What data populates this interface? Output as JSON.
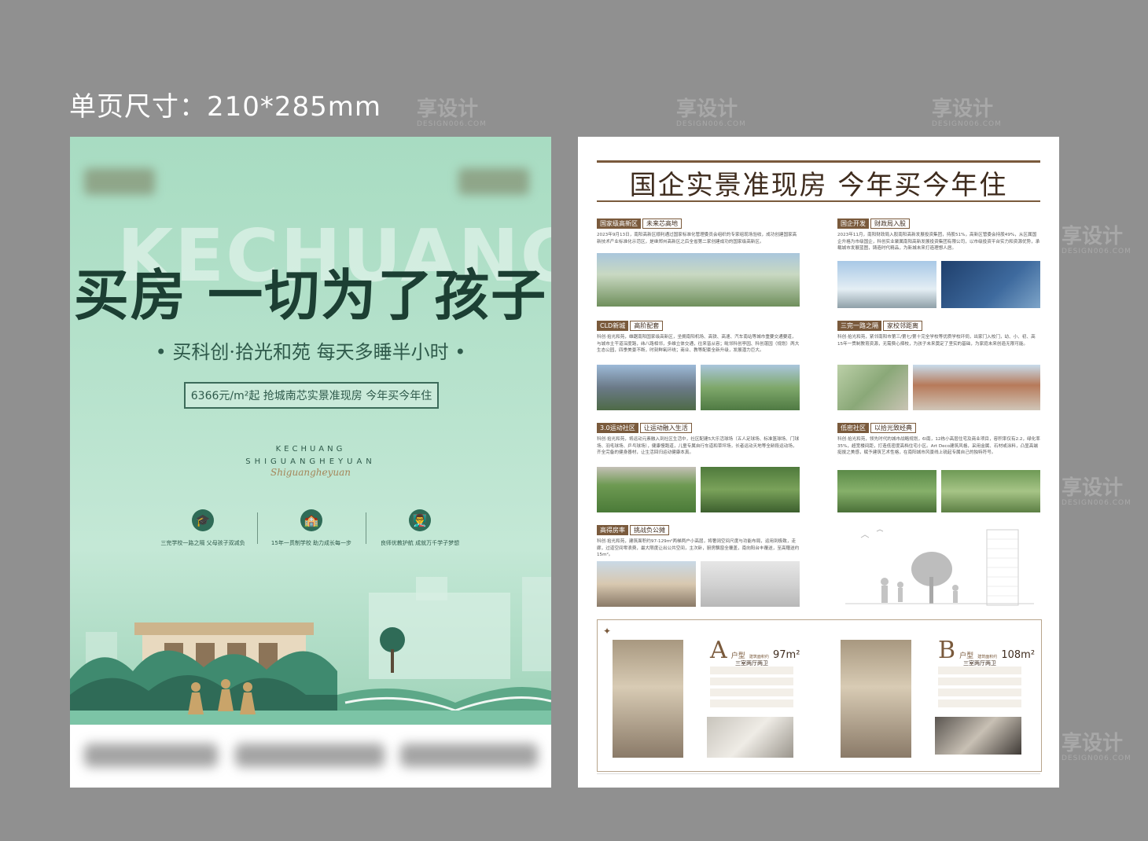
{
  "size_label": "单页尺寸：210*285mm",
  "watermark": {
    "brand": "享设计",
    "url": "DESIGN006.COM"
  },
  "poster": {
    "bg_word": "KECHUANG",
    "headline": "买房 一切为了孩子",
    "subline": "• 买科创·拾光和苑  每天多睡半小时 •",
    "price_banner": "6366元/m²起  抢城南芯实景准现房 今年买今年住",
    "brand_en_1": "KECHUANG",
    "brand_en_2": "SHIGUANGHEYUAN",
    "brand_script": "Shiguangheyuan",
    "features": [
      {
        "icon": "graduation-cap-icon",
        "glyph": "🎓",
        "text": "三完学校一路之隔  父母孩子双减负"
      },
      {
        "icon": "school-building-icon",
        "glyph": "🏫",
        "text": "15年一贯制学校  助力成长每一步"
      },
      {
        "icon": "teacher-student-icon",
        "glyph": "👨‍🏫",
        "text": "良师优教护航  成就万千学子梦想"
      }
    ],
    "colors": {
      "green_dark": "#1c3f33",
      "green": "#2f6b57",
      "gold": "#a5865a"
    }
  },
  "page": {
    "title": "国企实景准现房  今年买今年住",
    "sections": [
      {
        "tag": "国家级高新区",
        "tag2": "未来芯高地",
        "text": "2023年9月13日，南阳高新区顺利通过国家标准化管理委员会组织的专家组现场验收，成功创建国家高新技术产业标准化示范区，是继郑州高新区之后全省第二家创建成功的国家级高新区。"
      },
      {
        "tag": "国企开发",
        "tag2": "财政局入股",
        "text": "2023年11月，南阳财政局入股南阳高新发展投资集团，持股51%，高新区管委会持股49%，从区属国企升格为市级国企，科创实业聚属南阳高新发展投资集团有限公司，以市级投资平台实力和资源优势，承载城市发展蓝图，铸造时代精品，为新城未来打造理想人居。"
      },
      {
        "tag": "CLD新城",
        "tag2": "高阶配套",
        "text": "科创·拾光和苑，雄踞南阳国家级高新区，坐拥南阳机场、高铁、高速、汽车南站等城市重要交通要道，与城市主干道深度路，纬八路相邻，多维立体交通，往来皆从容；毗邻科创亭园、科创蓬园（规划）两大生态公园，四季美景不断，时刻鲜氧环绕；商业、教等配套全新升级，发展潜力巨大。"
      },
      {
        "tag": "三完一路之隔",
        "tag2": "家校邻距离",
        "text": "科创·拾光和苑，紧邻南阳市第三/第七/第十完全学校等优质学校环伺，出家门入校门，幼、小、初、高15年一贯制教育资源，无需费心择校，为孩子未来奠定了坚实的基础，为家庭未来创造无限可能。"
      },
      {
        "tag": "3.0运动社区",
        "tag2": "让运动融入生活",
        "text": "科创·拾光和苑，将运动元素融入到社区生活中，社区配建5大乐活球场（五人足球场、标准篮球场、门球场、羽毛球场、乒乓球场），健康慢跑道，儿童专属自行车道和草坪场，长者运动天地等全龄段运动场，齐全完备的健身器材，让生活回归运动健康本真。"
      },
      {
        "tag": "低密社区",
        "tag2": "以拾光致经典",
        "text": "科创·拾光和苑，领先时代的城市战略规划，6l南，12栋小高层住宅及商业项目，容积率仅有2.2，绿化率35%，超宽楼间距，打造低密度高档住宅小区。Art Deco建筑风格，采用金属、石材或涂料，凸显高端挺拔之美感，赋予建筑艺术性格，在南阳城市风景线上锐起专属自己的独特符号。"
      },
      {
        "tag": "高得房率",
        "tag2": "挑战负公摊",
        "text": "科创·拾光和苑，建筑面积约97-129m²两梯两户小高层，将奢阔空间尺度与功能布局，运用到极致，走廊，过道空间零浪费，最大限度让出公共空间，主次卧，厨房飘窗全覆盖，南向阳台丰覆送，至高赠送约15m²。"
      }
    ],
    "floorplans": [
      {
        "letter": "A",
        "unit_word": "户型",
        "area_label": "建筑面积约",
        "area": "97m²",
        "rooms": "三室两厅两卫"
      },
      {
        "letter": "B",
        "unit_word": "户型",
        "area_label": "建筑面积约",
        "area": "108m²",
        "rooms": "三室两厅两卫"
      }
    ],
    "colors": {
      "brown": "#7a5a3c",
      "brown_dark": "#3f2c1e"
    }
  }
}
